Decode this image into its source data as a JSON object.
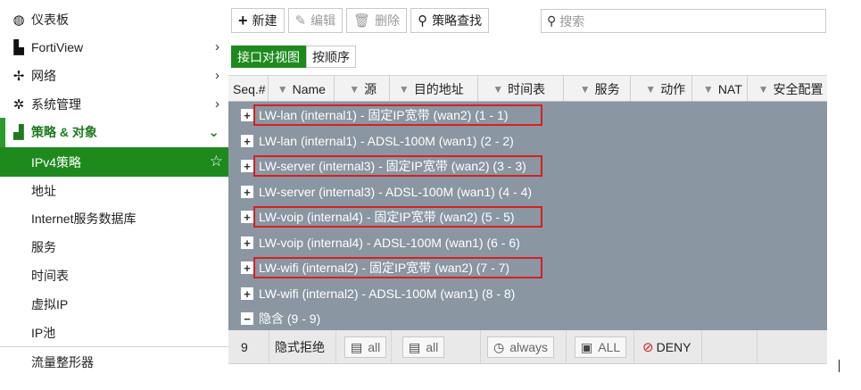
{
  "sidebar": {
    "items": [
      {
        "label": "仪表板",
        "icon": "dashboard-icon",
        "glyph": "◍",
        "chev": ""
      },
      {
        "label": "FortiView",
        "icon": "chart-icon",
        "glyph": "▙",
        "chev": "›"
      },
      {
        "label": "网络",
        "icon": "network-icon",
        "glyph": "✢",
        "chev": "›"
      },
      {
        "label": "系统管理",
        "icon": "gear-icon",
        "glyph": "✲",
        "chev": "›"
      },
      {
        "label": "策略 & 对象",
        "icon": "policy-icon",
        "glyph": "▟",
        "chev": "⌄"
      },
      {
        "label": "IPv4策略",
        "icon": "",
        "glyph": "",
        "chev": "☆"
      },
      {
        "label": "地址",
        "icon": "",
        "glyph": "",
        "chev": ""
      },
      {
        "label": "Internet服务数据库",
        "icon": "",
        "glyph": "",
        "chev": ""
      },
      {
        "label": "服务",
        "icon": "",
        "glyph": "",
        "chev": ""
      },
      {
        "label": "时间表",
        "icon": "",
        "glyph": "",
        "chev": ""
      },
      {
        "label": "虚拟IP",
        "icon": "",
        "glyph": "",
        "chev": ""
      },
      {
        "label": "IP池",
        "icon": "",
        "glyph": "",
        "chev": ""
      },
      {
        "label": "流量整形器",
        "icon": "",
        "glyph": "",
        "chev": ""
      }
    ]
  },
  "toolbar": {
    "new_label": "新建",
    "edit_label": "编辑",
    "delete_label": "删除",
    "find_label": "策略查找",
    "search_placeholder": "搜索"
  },
  "view_toggle": {
    "interface_view": "接口对视图",
    "sequence_view": "按顺序"
  },
  "table": {
    "columns": [
      "Seq.#",
      "Name",
      "源",
      "目的地址",
      "时间表",
      "服务",
      "动作",
      "NAT",
      "安全配置"
    ],
    "groups": [
      "LW-lan (internal1) - 固定IP宽带 (wan2) (1 - 1)",
      "LW-lan (internal1) - ADSL-100M (wan1) (2 - 2)",
      "LW-server (internal3) - 固定IP宽带 (wan2) (3 - 3)",
      "LW-server (internal3) - ADSL-100M (wan1) (4 - 4)",
      "LW-voip (internal4) - 固定IP宽带 (wan2) (5 - 5)",
      "LW-voip (internal4) - ADSL-100M (wan1) (6 - 6)",
      "LW-wifi (internal2) - 固定IP宽带 (wan2) (7 - 7)",
      "LW-wifi (internal2) - ADSL-100M (wan1) (8 - 8)",
      "隐含 (9 - 9)"
    ],
    "implicit_row": {
      "seq": "9",
      "name": "隐式拒绝",
      "source": "all",
      "destination": "all",
      "schedule": "always",
      "service": "ALL",
      "action": "DENY"
    }
  },
  "colors": {
    "accent_green": "#1e8a1e",
    "table_body": "#8a96a2",
    "highlight_red": "#d62020"
  }
}
